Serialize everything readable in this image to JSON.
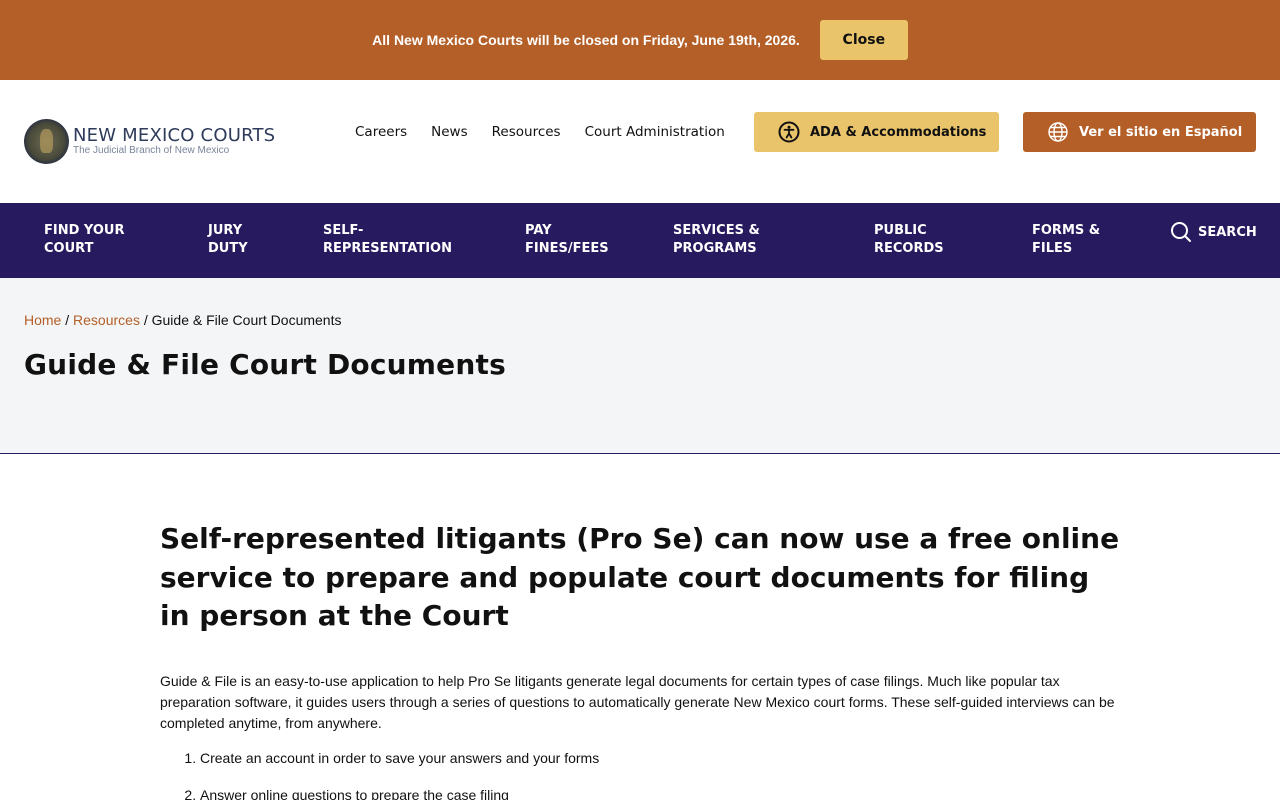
{
  "alert": {
    "text": "All New Mexico Courts will be closed on Friday, June 19th, 2026.",
    "close_label": "Close"
  },
  "header": {
    "logo_title": "NEW MEXICO COURTS",
    "logo_subtitle": "The Judicial Branch of New Mexico",
    "links": [
      "Careers",
      "News",
      "Resources",
      "Court Administration"
    ],
    "ada_label": "ADA & Accommodations",
    "spanish_label": "Ver el sitio en Español"
  },
  "nav": {
    "items": [
      {
        "line1": "FIND YOUR",
        "line2": "COURT"
      },
      {
        "line1": "JURY",
        "line2": "DUTY"
      },
      {
        "line1": "SELF-",
        "line2": "REPRESENTATION"
      },
      {
        "line1": "PAY",
        "line2": "FINES/FEES"
      },
      {
        "line1": "SERVICES &",
        "line2": "PROGRAMS"
      },
      {
        "line1": "PUBLIC",
        "line2": "RECORDS"
      },
      {
        "line1": "FORMS &",
        "line2": "FILES"
      }
    ],
    "search_label": "SEARCH"
  },
  "breadcrumb": {
    "home": "Home",
    "resources": "Resources",
    "current": "Guide & File Court Documents",
    "separator": "/"
  },
  "page_title": "Guide & File Court Documents",
  "content": {
    "heading": "Self-represented litigants (Pro Se) can now use a free online service to prepare and populate court documents for filing in person at the Court",
    "intro": "Guide & File is an easy-to-use application to help Pro Se litigants generate legal documents for certain types of case filings. Much like popular tax preparation software, it guides users through a series of questions to automatically generate New Mexico court forms. These self-guided interviews can be completed anytime, from anywhere.",
    "steps": [
      "Create an account in order to save your answers and your forms",
      "Answer online questions to prepare the case filing"
    ]
  },
  "colors": {
    "accent_orange": "#b45f27",
    "accent_gold": "#e9c46a",
    "nav_navy": "#271a5e"
  }
}
